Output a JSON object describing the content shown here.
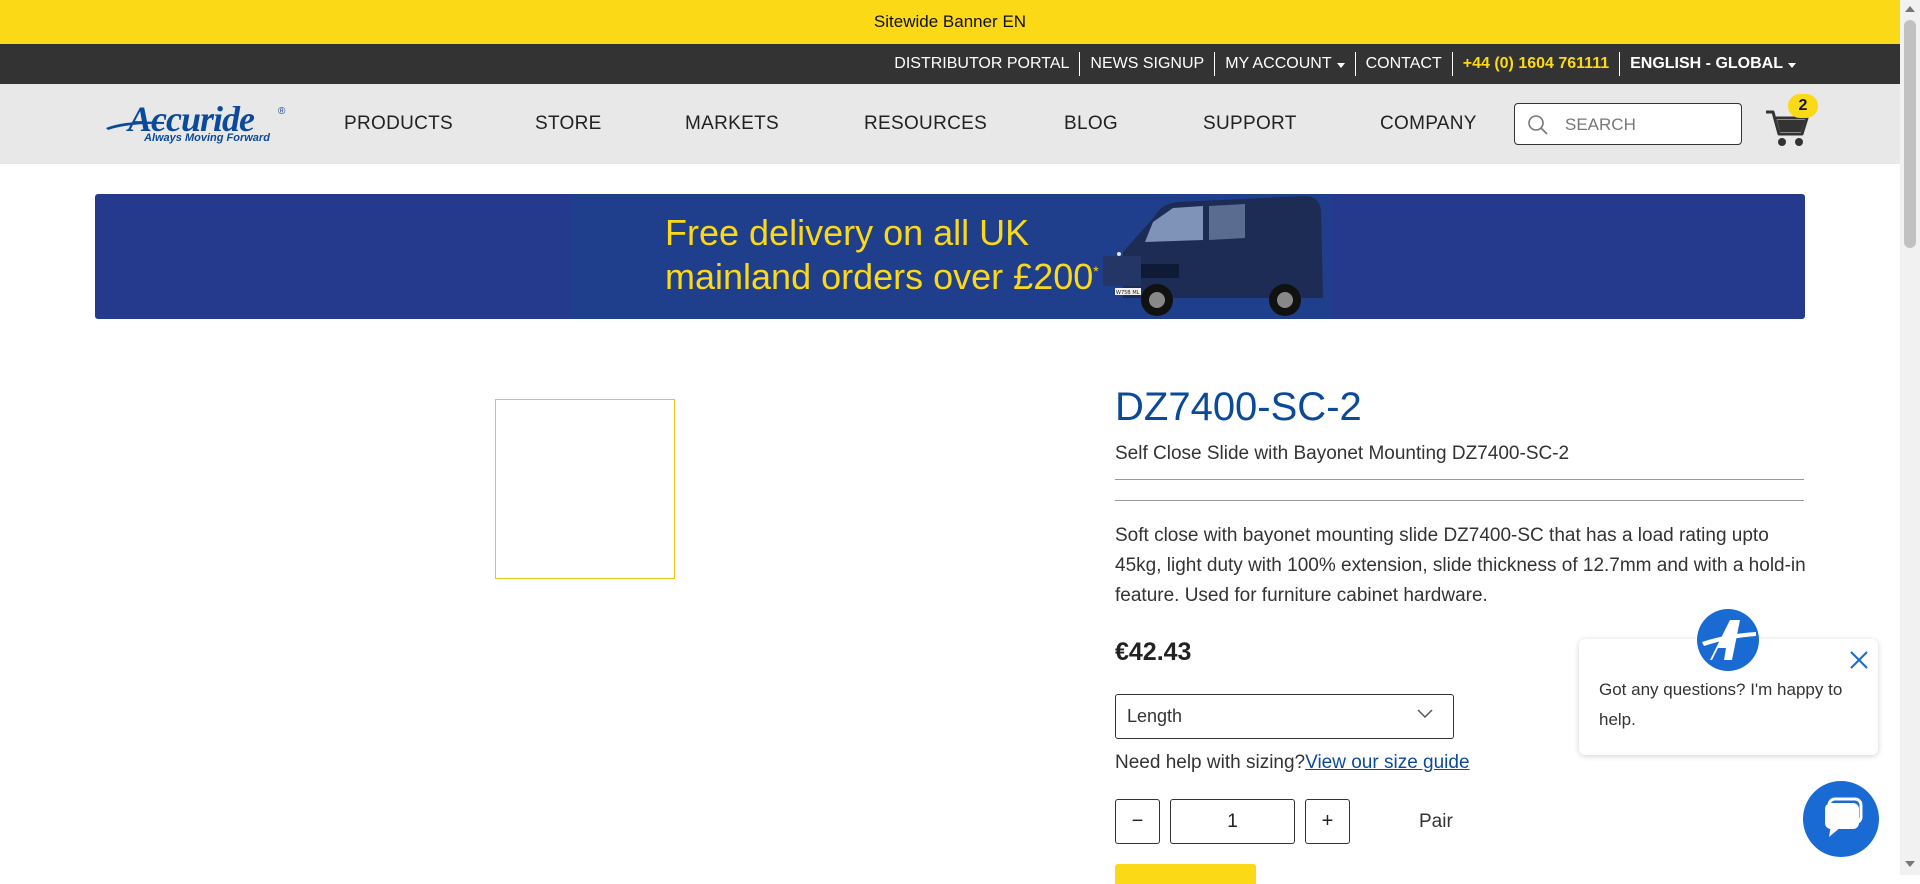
{
  "sitewide_banner": "Sitewide Banner EN",
  "utility_nav": {
    "distributor_portal": "DISTRIBUTOR PORTAL",
    "news_signup": "NEWS SIGNUP",
    "my_account": "MY ACCOUNT",
    "contact": "CONTACT",
    "phone": "+44 (0) 1604 761111",
    "language": "ENGLISH - GLOBAL"
  },
  "logo": {
    "wordmark": "Accuride",
    "registered": "®",
    "tagline": "Always Moving Forward"
  },
  "main_nav": {
    "items": [
      "PRODUCTS",
      "STORE",
      "MARKETS",
      "RESOURCES",
      "BLOG",
      "SUPPORT",
      "COMPANY"
    ]
  },
  "search": {
    "placeholder": "SEARCH"
  },
  "cart": {
    "count": "2"
  },
  "promo": {
    "line1": "Free delivery on all UK",
    "line2": "mainland orders over £200",
    "asterisk": "*",
    "van_plate": "W75B ML"
  },
  "product": {
    "sku": "DZ7400-SC-2",
    "subtitle": "Self Close Slide with Bayonet Mounting DZ7400-SC-2",
    "description": "Soft close with bayonet mounting slide DZ7400-SC that has a load rating upto 45kg, light duty with 100% extension, slide thickness of 12.7mm and with a hold-in feature. Used for furniture cabinet hardware.",
    "price": "€42.43",
    "length_select": "Length",
    "sizing_prompt": "Need help with sizing?",
    "size_guide_link": "View our size guide",
    "qty_minus": "−",
    "qty_value": "1",
    "qty_plus": "+",
    "unit": "Pair"
  },
  "chat": {
    "message": "Got any questions? I'm happy to help."
  },
  "colors": {
    "brand_yellow": "#fcd917",
    "brand_blue": "#0b4a9a",
    "dark_bar": "#333333",
    "nav_bg": "#e8e8e8",
    "promo_bg": "#263a8d",
    "chat_blue": "#1a6ad3"
  },
  "icons": {
    "search": "search-icon",
    "cart": "cart-icon",
    "chevron": "chevron-down-icon",
    "close": "close-icon",
    "chat": "chat-bubble-icon"
  }
}
